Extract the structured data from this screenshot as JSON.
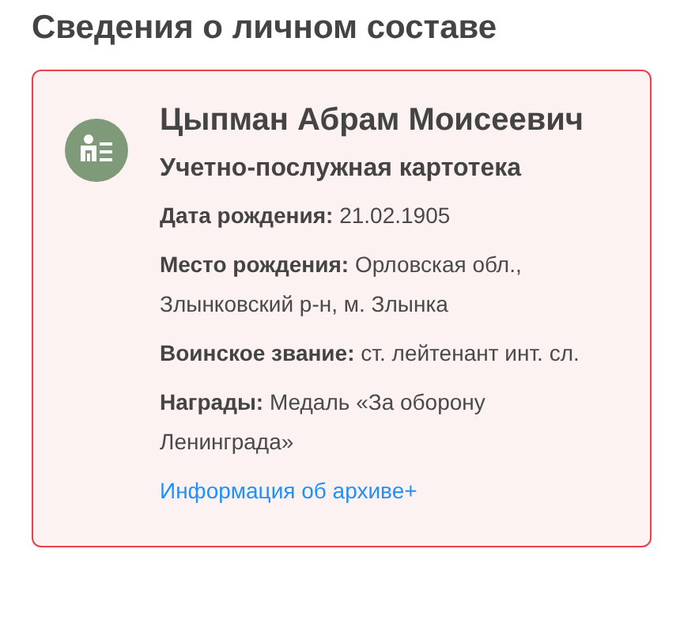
{
  "heading": "Сведения о личном составе",
  "card": {
    "name": "Цыпман Абрам Моисеевич",
    "subtitle": "Учетно-послужная картотека",
    "fields": [
      {
        "label": "Дата рождения:",
        "value": "21.02.1905"
      },
      {
        "label": "Место рождения:",
        "value": "Орловская обл., Злынковский р-н, м. Злынка"
      },
      {
        "label": "Воинское звание:",
        "value": "ст. лейтенант инт. сл."
      },
      {
        "label": "Награды:",
        "value": "Медаль «За оборону Ленинграда»"
      }
    ],
    "link": "Информация об архиве+"
  }
}
